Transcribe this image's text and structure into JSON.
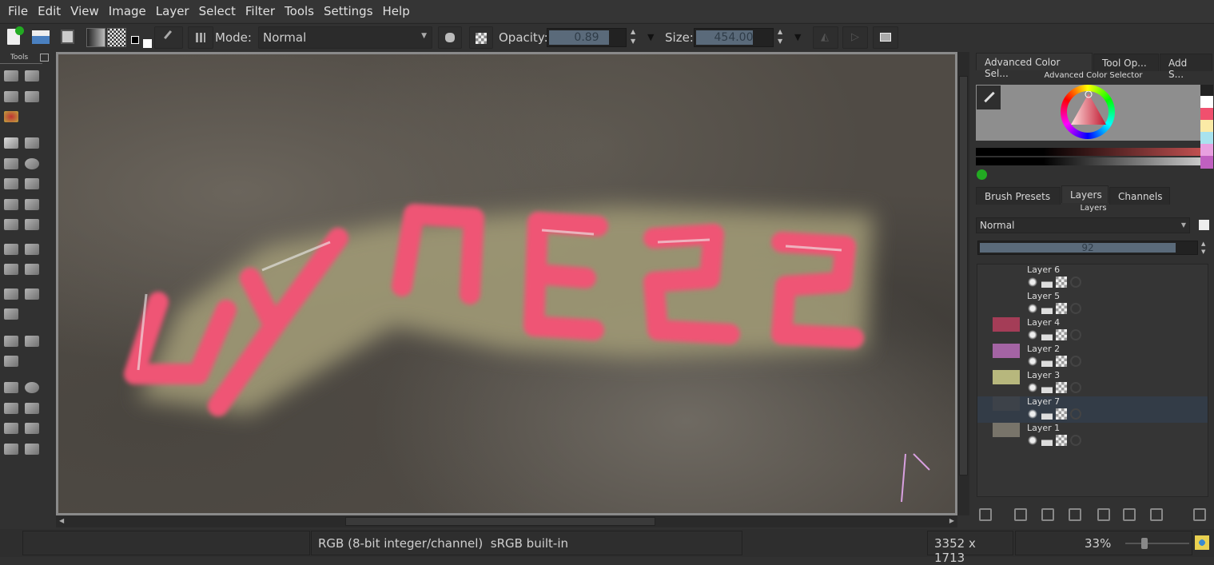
{
  "menu": [
    "File",
    "Edit",
    "View",
    "Image",
    "Layer",
    "Select",
    "Filter",
    "Tools",
    "Settings",
    "Help"
  ],
  "toolbar": {
    "mode_label": "Mode:",
    "mode_value": "Normal",
    "opacity_label": "Opacity:",
    "opacity_value": "0.89",
    "opacity": 0.89,
    "size_label": "Size:",
    "size_value": "454.00",
    "icons": [
      "new-document-icon",
      "open-document-icon",
      "save-icon",
      "gradient-icon",
      "pattern-icon",
      "fg-bg-color-icon",
      "brush-preset-icon",
      "brush-settings-icon",
      "erase-mode-icon",
      "preserve-alpha-icon",
      "mirror-horizontal-icon",
      "mirror-vertical-icon",
      "workspace-icon"
    ]
  },
  "toolbox": {
    "title": "Tools",
    "tools": [
      "select-shapes-icon",
      "text-icon",
      "pattern-edit-icon",
      "calligraphy-icon",
      "fill-icon",
      "freehand-brush-icon",
      "line-icon",
      "rectangle-icon",
      "ellipse-icon",
      "polygon-icon",
      "polyline-icon",
      "bezier-icon",
      "path-icon",
      "freehand-path-icon",
      "dynamic-brush-icon",
      "crop-icon",
      "move-icon",
      "transform-icon",
      "perspective-icon",
      "fill-bucket-icon",
      "color-picker-icon",
      "gradient-tool-icon",
      "measure-icon",
      "assistant-icon",
      "grid-icon",
      "rect-select-icon",
      "ellipse-select-icon",
      "polygon-select-icon",
      "freehand-select-icon",
      "contiguous-select-icon",
      "magic-wand-icon",
      "bezier-select-icon",
      "similar-select-icon"
    ]
  },
  "right": {
    "top_tabs": [
      "Advanced Color Sel...",
      "Tool Op...",
      "Add S..."
    ],
    "color_selector_title": "Advanced Color Selector",
    "swatches": [
      "#ffffff",
      "#f0506e",
      "#fbeaa6",
      "#a8e2ee",
      "#e8a0e0",
      "#c060c0"
    ],
    "mid_tabs": [
      "Brush Presets",
      "Layers",
      "Channels"
    ],
    "layers_title": "Layers",
    "blend_mode": "Normal",
    "layer_opacity": "92",
    "layers": [
      {
        "name": "Layer 6",
        "selected": false
      },
      {
        "name": "Layer 5",
        "selected": false
      },
      {
        "name": "Layer 4",
        "selected": false
      },
      {
        "name": "Layer 2",
        "selected": false
      },
      {
        "name": "Layer 3",
        "selected": false
      },
      {
        "name": "Layer 7",
        "selected": true
      },
      {
        "name": "Layer 1",
        "selected": false
      }
    ],
    "layer_buttons": [
      "add-layer-icon",
      "duplicate-layer-icon",
      "move-down-icon",
      "move-up-icon",
      "move-out-icon",
      "move-in-icon",
      "layer-properties-icon",
      "delete-layer-icon"
    ]
  },
  "status": {
    "color_space": "RGB (8-bit integer/channel)  sRGB built-in",
    "dimensions": "3352 x 1713",
    "zoom": "33%",
    "zoom_value": 33
  },
  "colors": {
    "accent": "#f0506e",
    "selection": "#333c47"
  }
}
